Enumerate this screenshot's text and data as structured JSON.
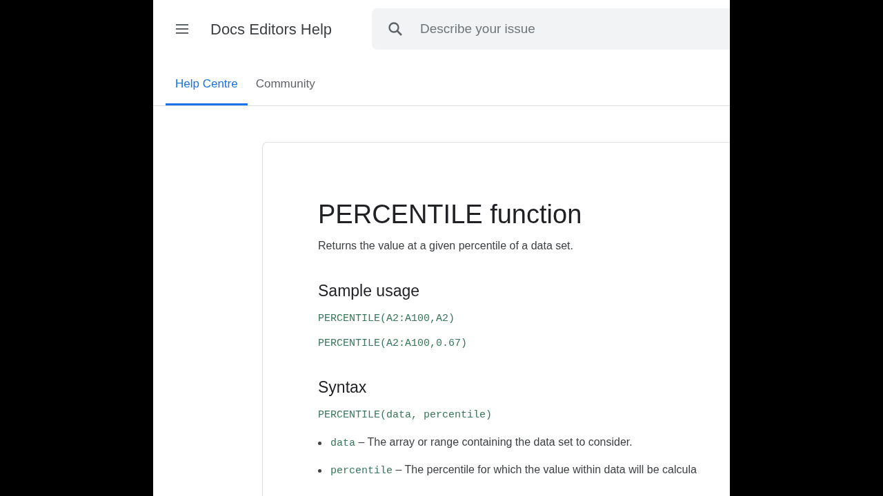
{
  "header": {
    "title": "Docs Editors Help",
    "search": {
      "placeholder": "Describe your issue"
    }
  },
  "tabs": [
    {
      "label": "Help Centre",
      "selected": true
    },
    {
      "label": "Community",
      "selected": false
    }
  ],
  "article": {
    "title": "PERCENTILE function",
    "summary": "Returns the value at a given percentile of a data set.",
    "sections": [
      {
        "heading": "Sample usage",
        "code": [
          "PERCENTILE(A2:A100,A2)",
          "PERCENTILE(A2:A100,0.67)"
        ]
      },
      {
        "heading": "Syntax",
        "code": [
          "PERCENTILE(data, percentile)"
        ],
        "params": [
          {
            "term": "data",
            "text": "– The array or range containing the data set to consider."
          },
          {
            "term": "percentile",
            "text": "– The percentile for which the value within data will be calcula"
          }
        ]
      }
    ]
  }
}
